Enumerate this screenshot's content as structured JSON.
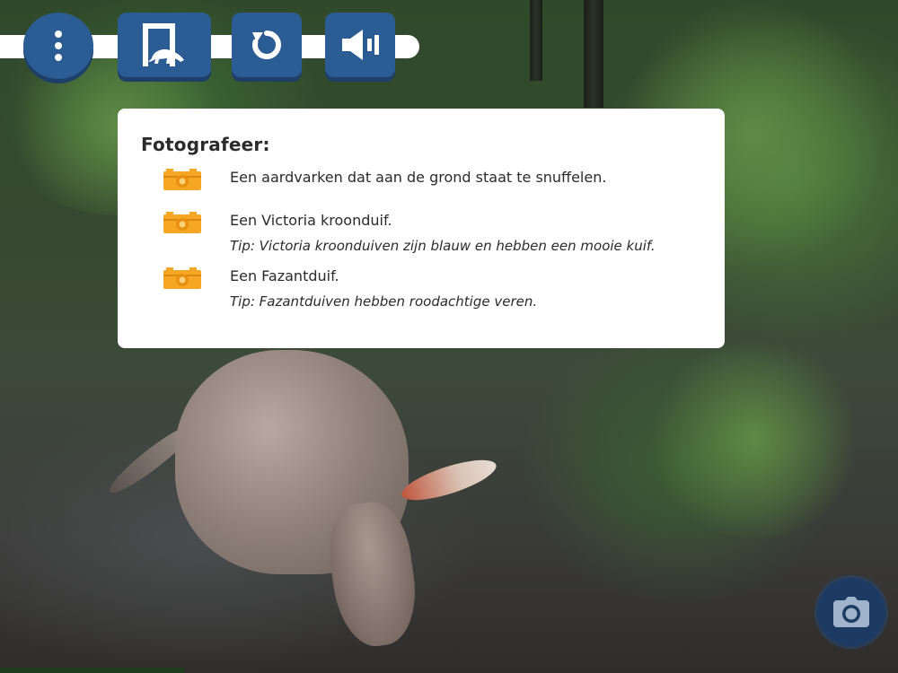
{
  "toolbar": {
    "menu_icon": "more-vertical-icon",
    "exit_icon": "exit-door-aardvark-icon",
    "reset_icon": "restart-icon",
    "sound_icon": "speaker-icon"
  },
  "task_card": {
    "title": "Fotografeer:",
    "tasks": [
      {
        "icon": "camera-icon",
        "text": "Een aardvarken dat aan de grond staat te snuffelen.",
        "tip": ""
      },
      {
        "icon": "camera-icon",
        "text": "Een Victoria kroonduif.",
        "tip": "Tip: Victoria kroonduiven zijn blauw en hebben een mooie kuif."
      },
      {
        "icon": "camera-icon",
        "text": "Een Fazantduif.",
        "tip": "Tip: Fazantduiven hebben roodachtige veren."
      }
    ]
  },
  "shutter": {
    "icon": "camera-icon"
  },
  "colors": {
    "button_blue": "#2c5c94",
    "button_shadow": "#1d3f69",
    "task_icon": "#f5a623",
    "shutter": "#1d3a63"
  }
}
